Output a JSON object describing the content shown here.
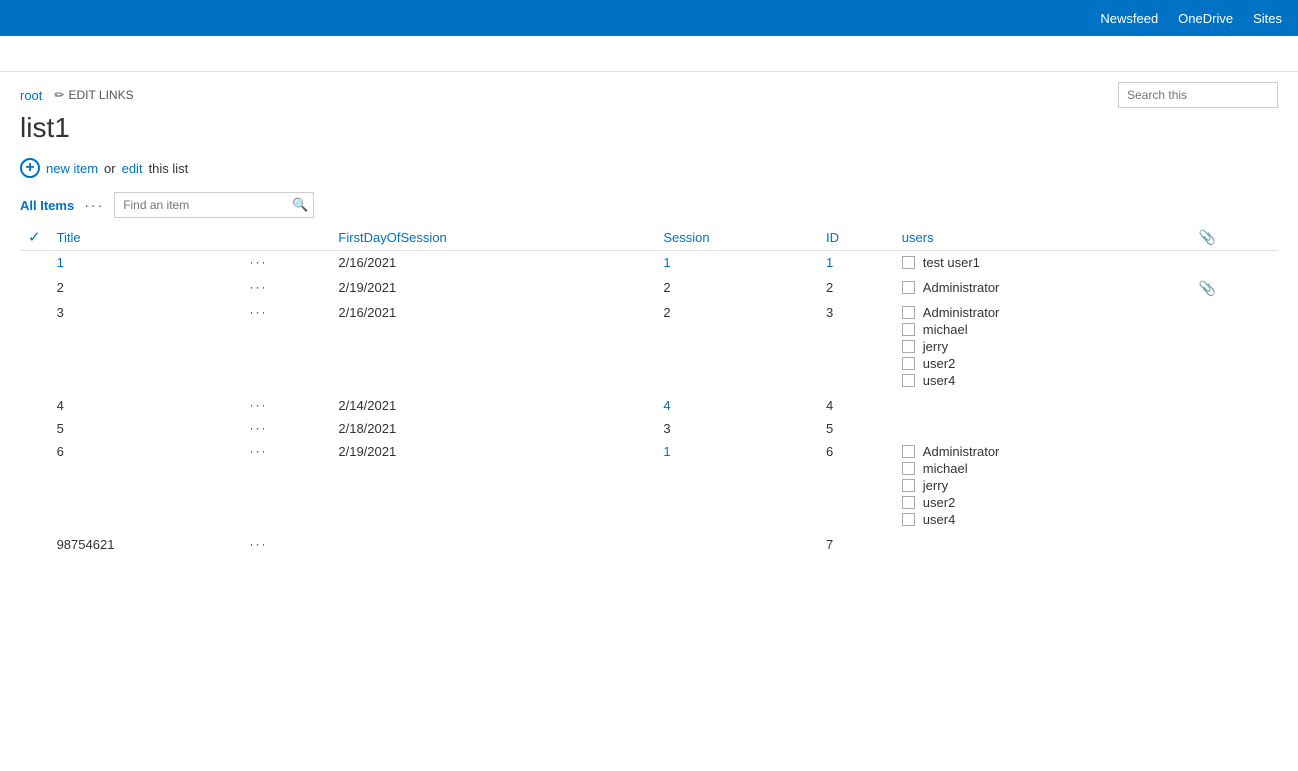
{
  "topnav": {
    "items": [
      "Newsfeed",
      "OneDrive",
      "Sites"
    ]
  },
  "breadcrumb": {
    "root": "root",
    "edit_links": "EDIT LINKS"
  },
  "search": {
    "placeholder": "Search this"
  },
  "page_title": "list1",
  "new_item": {
    "new_text": "new item",
    "or_text": "or",
    "edit_text": "edit",
    "this_list_text": "this list"
  },
  "view": {
    "all_items": "All Items",
    "dots": "···",
    "find_placeholder": "Find an item"
  },
  "columns": {
    "check": "",
    "title": "Title",
    "dots": "",
    "first_day": "FirstDayOfSession",
    "session": "Session",
    "id": "ID",
    "users": "users",
    "attach": ""
  },
  "rows": [
    {
      "title": "1",
      "title_link": true,
      "first_day": "2/16/2021",
      "session": "1",
      "session_link": true,
      "id": "1",
      "id_link": true,
      "users": [
        {
          "name": "test user1",
          "checked": false
        }
      ],
      "has_attach": false
    },
    {
      "title": "2",
      "title_link": false,
      "first_day": "2/19/2021",
      "session": "2",
      "session_link": false,
      "id": "2",
      "id_link": false,
      "users": [
        {
          "name": "Administrator",
          "checked": false
        }
      ],
      "has_attach": true
    },
    {
      "title": "3",
      "title_link": false,
      "first_day": "2/16/2021",
      "session": "2",
      "session_link": false,
      "id": "3",
      "id_link": false,
      "users": [
        {
          "name": "Administrator",
          "checked": false
        },
        {
          "name": "michael",
          "checked": false
        },
        {
          "name": "jerry",
          "checked": false
        },
        {
          "name": "user2",
          "checked": false
        },
        {
          "name": "user4",
          "checked": false
        }
      ],
      "has_attach": false
    },
    {
      "title": "4",
      "title_link": false,
      "first_day": "2/14/2021",
      "session": "4",
      "session_link": true,
      "id": "4",
      "id_link": false,
      "users": [],
      "has_attach": false
    },
    {
      "title": "5",
      "title_link": false,
      "first_day": "2/18/2021",
      "session": "3",
      "session_link": false,
      "id": "5",
      "id_link": false,
      "users": [],
      "has_attach": false
    },
    {
      "title": "6",
      "title_link": false,
      "first_day": "2/19/2021",
      "session": "1",
      "session_link": true,
      "id": "6",
      "id_link": false,
      "users": [
        {
          "name": "Administrator",
          "checked": false
        },
        {
          "name": "michael",
          "checked": false
        },
        {
          "name": "jerry",
          "checked": false
        },
        {
          "name": "user2",
          "checked": false
        },
        {
          "name": "user4",
          "checked": false
        }
      ],
      "has_attach": false
    },
    {
      "title": "98754621",
      "title_link": false,
      "first_day": "",
      "session": "",
      "session_link": false,
      "id": "7",
      "id_link": false,
      "users": [],
      "has_attach": false
    }
  ]
}
